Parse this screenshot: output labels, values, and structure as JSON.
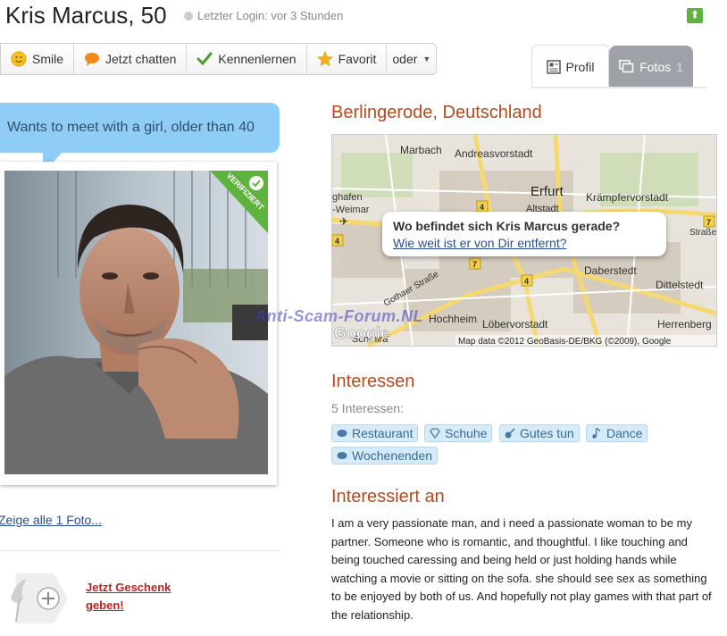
{
  "profile": {
    "name_age": "Kris Marcus, 50",
    "last_login": "Letzter Login: vor 3 Stunden"
  },
  "toolbar": {
    "smile": "Smile",
    "chat": "Jetzt chatten",
    "meet": "Kennenlernen",
    "favorite": "Favorit",
    "more": "oder"
  },
  "tabs": {
    "profil": "Profil",
    "fotos": "Fotos",
    "fotos_count": "1"
  },
  "left": {
    "bubble_text": "Wants to meet with a girl, older than 40",
    "verified_badge": "VERIFIZIERT",
    "all_photos_link": "Zeige alle 1 Foto...",
    "gift_line1": "Jetzt Geschenk",
    "gift_line2": "geben!"
  },
  "location": {
    "title": "Berlingerode, Deutschland"
  },
  "map": {
    "popup_title": "Wo befindet sich Kris Marcus gerade?",
    "popup_link": "Wie weit ist er von Dir entfernt?",
    "labels": [
      "Marbach",
      "Andreasvorstadt",
      "Erfurt",
      "Altstadt",
      "Krämpfervorstadt",
      "ghafen",
      "-Weimar",
      "Daberstedt",
      "Dittelstedt",
      "Gothaer Straße",
      "Hochheim",
      "Löbervorstadt",
      "Herrenberg",
      "Schmira",
      "Straße"
    ],
    "road_numbers": [
      "4",
      "4",
      "7",
      "7",
      "4"
    ],
    "attribution": "Map data ©2012 GeoBasis-DE/BKG (©2009), Google",
    "logo": "Google"
  },
  "interests": {
    "title": "Interessen",
    "count": "5 Interessen:",
    "tags": [
      "Restaurant",
      "Schuhe",
      "Gutes tun",
      "Dance",
      "Wochenenden"
    ]
  },
  "interested_in": {
    "title": "Interessiert an",
    "text": "I am a very passionate man, and i need a passionate woman to be my partner. Someone who is romantic, and thoughtful. I like touching and being touched caressing and being held or just holding hands while watching a movie or sitting on the sofa. she should see sex as something to be enjoyed by both of us. And hopefully not play games with that part of the relationship."
  },
  "watermark": "Anti-Scam-Forum.NL",
  "colors": {
    "heading": "#b84a1e",
    "bubble": "#8fcdf6",
    "tag_bg": "#d6ebf9",
    "verified": "#5db33b"
  }
}
